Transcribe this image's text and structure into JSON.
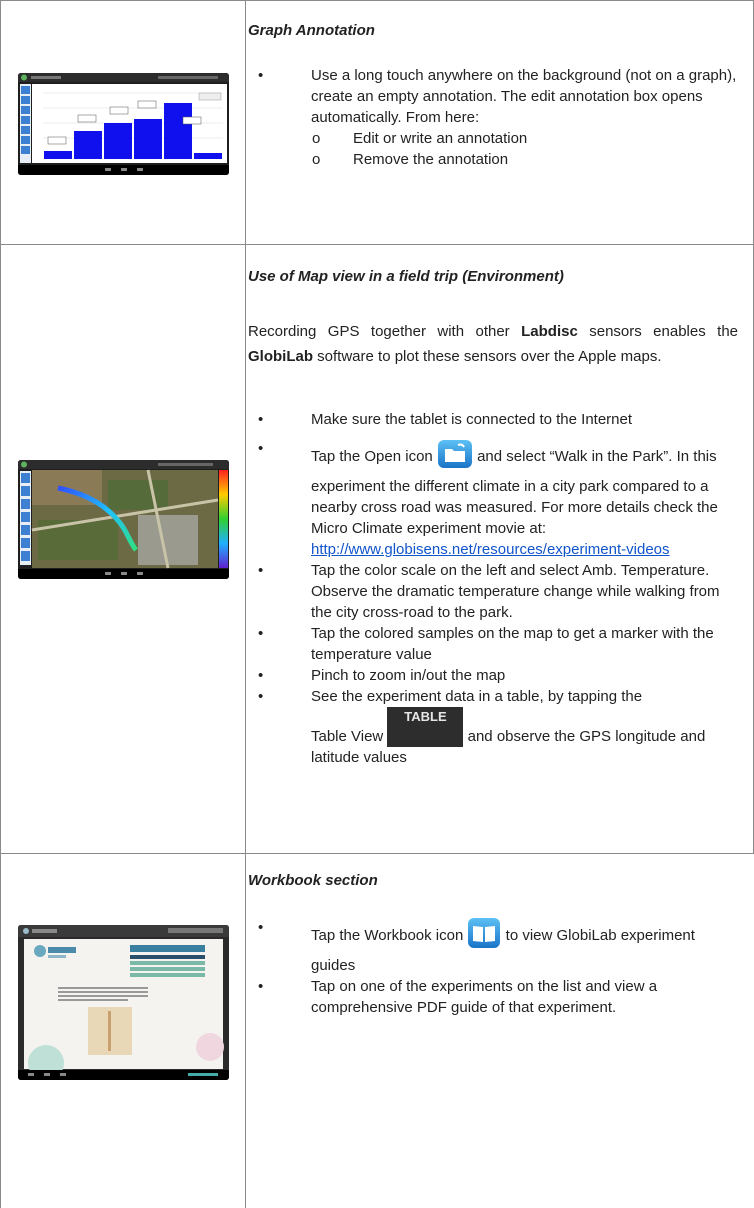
{
  "row1": {
    "heading": "Graph Annotation",
    "bullet1": "Use a long touch anywhere on the background (not on a graph), create an empty annotation. The edit annotation box opens automatically. From here:",
    "sub": [
      "Edit or write an annotation",
      "Remove the annotation"
    ],
    "thumb_icon": "bar-graph-screenshot"
  },
  "row2": {
    "heading": "Use of Map view in a field trip (Environment)",
    "para_a": "Recording GPS together with other ",
    "para_b1": "Labdisc",
    "para_c": " sensors enables the ",
    "para_b2": "GlobiLab",
    "para_d": " software to plot these sensors over the Apple maps.",
    "b1": "Make sure the tablet is connected to the Internet",
    "b2a": "Tap the Open icon ",
    "b2b": " and select “Walk in the Park”. In this experiment the different climate in a city park compared to a nearby cross road was measured. For more details check the Micro Climate experiment movie at: ",
    "b2link": "http://www.globisens.net/resources/experiment-videos",
    "b3": "Tap the color scale on the left and select Amb. Temperature. Observe the dramatic temperature change while walking from the city cross-road to the park.",
    "b4": "Tap the colored samples on the map to get a marker with the temperature value",
    "b5": "Pinch to zoom in/out the map",
    "b6a": "See the experiment data in a table, by tapping the",
    "b6b": "Table View",
    "b6c": " and observe the GPS longitude and latitude values",
    "table_button": "TABLE",
    "open_icon": "folder-open-icon",
    "thumb_icon": "map-screenshot"
  },
  "row3": {
    "heading": "Workbook section",
    "b1a": "Tap the Workbook icon ",
    "b1b": " to view GlobiLab experiment guides",
    "b2": "Tap on one of the experiments on the list and view a comprehensive PDF guide of that experiment.",
    "book_icon": "workbook-icon",
    "thumb_icon": "workbook-screenshot"
  }
}
